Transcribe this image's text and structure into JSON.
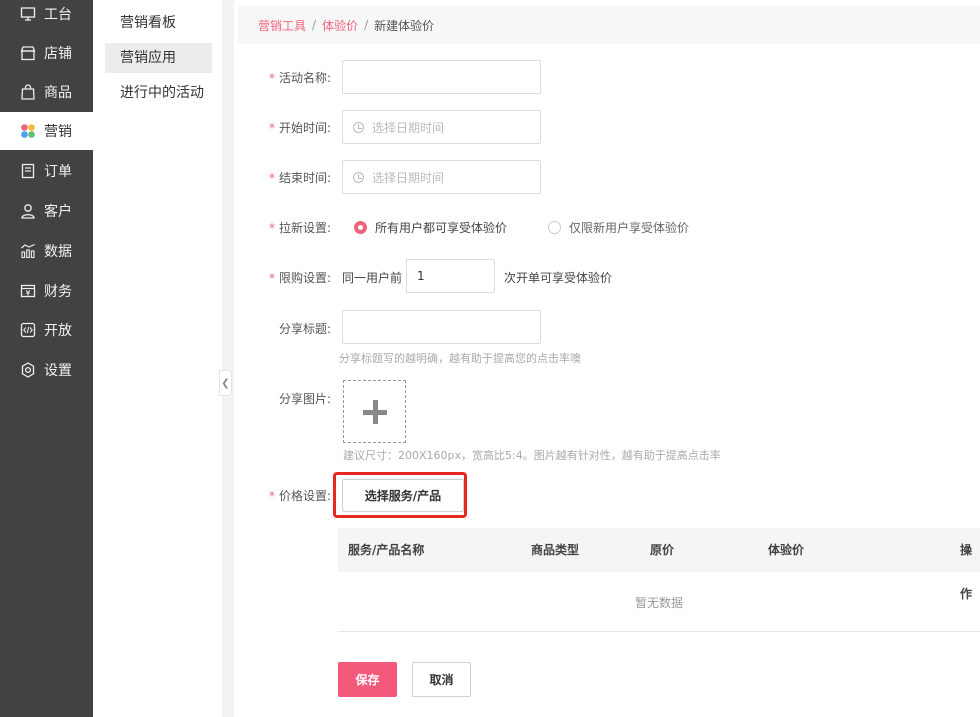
{
  "nav": {
    "items": [
      {
        "label": "工台",
        "icon": "monitor-icon"
      },
      {
        "label": "店铺",
        "icon": "store-icon"
      },
      {
        "label": "商品",
        "icon": "shopping-bag-icon"
      },
      {
        "label": "营销",
        "icon": "marketing-petals-icon",
        "active": true
      },
      {
        "label": "订单",
        "icon": "order-icon"
      },
      {
        "label": "客户",
        "icon": "user-icon"
      },
      {
        "label": "数据",
        "icon": "chart-icon"
      },
      {
        "label": "财务",
        "icon": "finance-icon"
      },
      {
        "label": "开放",
        "icon": "code-icon"
      },
      {
        "label": "设置",
        "icon": "gear-icon"
      }
    ]
  },
  "submenu": {
    "items": [
      {
        "label": "营销看板"
      },
      {
        "label": "营销应用",
        "active": true
      },
      {
        "label": "进行中的活动"
      }
    ]
  },
  "breadcrumb": {
    "item1": "营销工具",
    "item2": "体验价",
    "current": "新建体验价",
    "sep": "/"
  },
  "form": {
    "required_mark": "*",
    "activity_name": {
      "label": "活动名称:",
      "value": ""
    },
    "start_time": {
      "label": "开始时间:",
      "placeholder": "选择日期时间"
    },
    "end_time": {
      "label": "结束时间:",
      "placeholder": "选择日期时间"
    },
    "new_user": {
      "label": "拉新设置:",
      "option_all": "所有用户都可享受体验价",
      "option_new": "仅限新用户享受体验价",
      "selected": "option_all"
    },
    "limit": {
      "label": "限购设置:",
      "prefix": "同一用户前",
      "value": "1",
      "suffix": "次开单可享受体验价"
    },
    "share_title": {
      "label": "分享标题:",
      "value": "",
      "hint": "分享标题写的越明确，越有助于提高您的点击率噢"
    },
    "share_image": {
      "label": "分享图片:",
      "hint": "建议尺寸：200X160px，宽高比5:4。图片越有针对性，越有助于提高点击率"
    },
    "price": {
      "label": "价格设置:",
      "button": "选择服务/产品"
    }
  },
  "table": {
    "columns": [
      "服务/产品名称",
      "商品类型",
      "原价",
      "体验价",
      "操作"
    ],
    "empty_text": "暂无数据"
  },
  "actions": {
    "save": "保存",
    "cancel": "取消"
  },
  "colors": {
    "accent": "#f0647e",
    "primary_button": "#f4587a",
    "nav_bg": "#424242",
    "highlight": "#e32a21"
  }
}
